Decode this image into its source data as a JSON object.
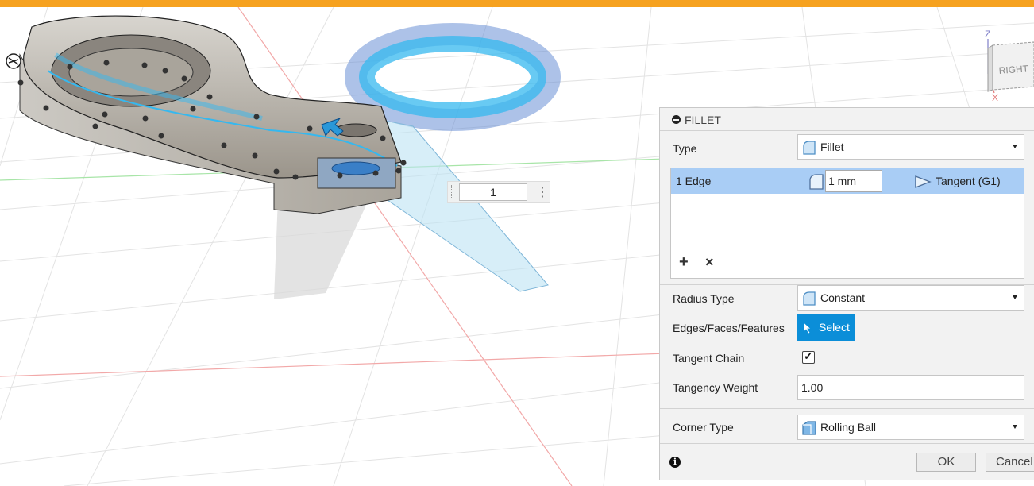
{
  "viewport": {
    "input_value": "1",
    "viewcube": {
      "face_label": "RIGHT",
      "z_label": "Z",
      "x_label": "X"
    }
  },
  "panel": {
    "title": "FILLET",
    "type_label": "Type",
    "type_value": "Fillet",
    "edge_row": {
      "name": "1 Edge",
      "radius": "1 mm",
      "continuity": "Tangent (G1)"
    },
    "add_symbol": "+",
    "remove_symbol": "×",
    "radius_type_label": "Radius Type",
    "radius_type_value": "Constant",
    "edges_label": "Edges/Faces/Features",
    "select_label": "Select",
    "tangent_chain_label": "Tangent Chain",
    "tangent_chain_checked": true,
    "tangency_weight_label": "Tangency Weight",
    "tangency_weight_value": "1.00",
    "corner_type_label": "Corner Type",
    "corner_type_value": "Rolling Ball",
    "ok_label": "OK",
    "cancel_label": "Cancel",
    "info_symbol": "i"
  },
  "colors": {
    "accent_bar": "#f6a220",
    "selection_row": "#a9cdf5",
    "select_button": "#0b8ed8",
    "preview_blue": "#35b8ef"
  }
}
